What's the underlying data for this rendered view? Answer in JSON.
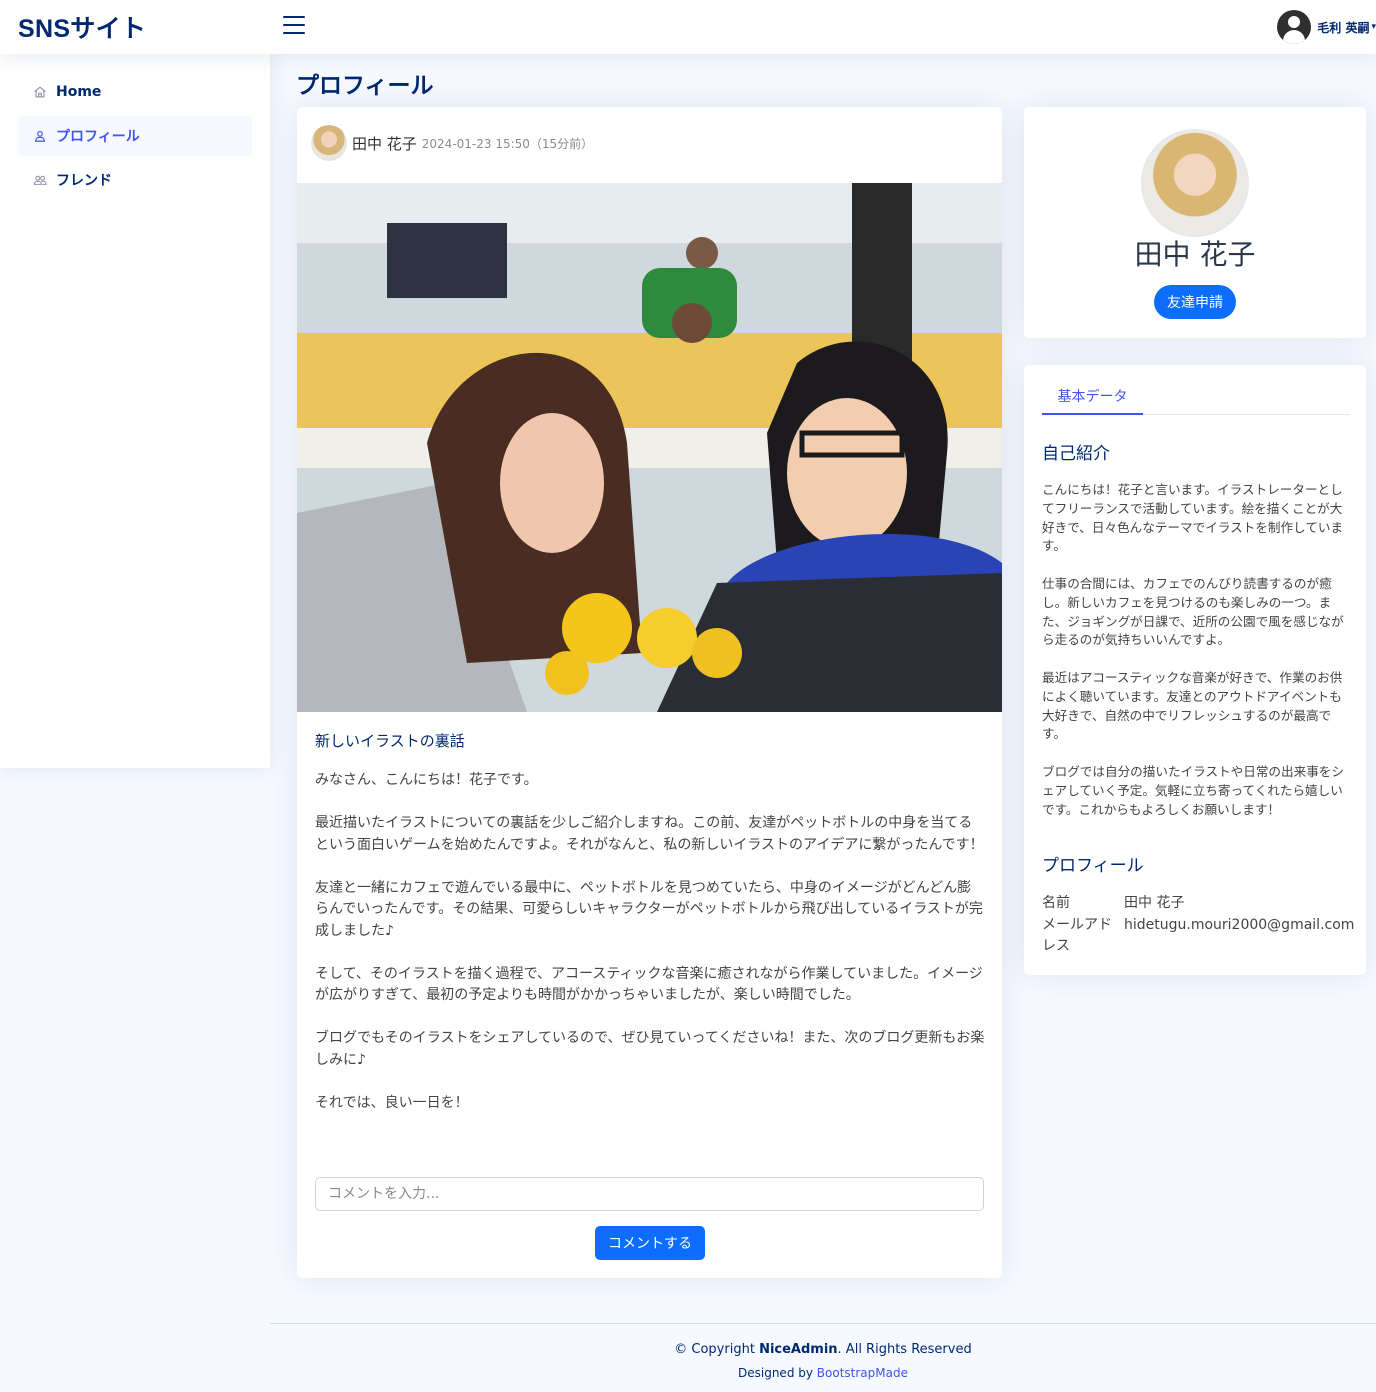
{
  "app": {
    "logo": "SNSサイト"
  },
  "header": {
    "user_name": "毛利 英嗣"
  },
  "sidebar": {
    "items": [
      {
        "label": "Home",
        "icon": "house-icon",
        "active": false
      },
      {
        "label": "プロフィール",
        "icon": "person-icon",
        "active": true
      },
      {
        "label": "フレンド",
        "icon": "people-icon",
        "active": false
      }
    ]
  },
  "page": {
    "title": "プロフィール"
  },
  "post": {
    "author": "田中 花子",
    "date": "2024-01-23 15:50（15分前）",
    "image_alt": "office-photo-two-women-at-computer",
    "title": "新しいイラストの裏話",
    "paragraphs": [
      "みなさん、こんにちは！花子です。",
      "最近描いたイラストについての裏話を少しご紹介しますね。この前、友達がペットボトルの中身を当てるという面白いゲームを始めたんですよ。それがなんと、私の新しいイラストのアイデアに繋がったんです！",
      "友達と一緒にカフェで遊んでいる最中に、ペットボトルを見つめていたら、中身のイメージがどんどん膨らんでいったんです。その結果、可愛らしいキャラクターがペットボトルから飛び出しているイラストが完成しました♪",
      "そして、そのイラストを描く過程で、アコースティックな音楽に癒されながら作業していました。イメージが広がりすぎて、最初の予定よりも時間がかかっちゃいましたが、楽しい時間でした。",
      "ブログでもそのイラストをシェアしているので、ぜひ見ていってくださいね！また、次のブログ更新もお楽しみに♪",
      "それでは、良い一日を！"
    ],
    "comment_placeholder": "コメントを入力...",
    "comment_button": "コメントする"
  },
  "profile": {
    "name": "田中 花子",
    "friend_button": "友達申請"
  },
  "details": {
    "tab": "基本データ",
    "bio_title": "自己紹介",
    "bio": [
      "こんにちは！花子と言います。イラストレーターとしてフリーランスで活動しています。絵を描くことが大好きで、日々色んなテーマでイラストを制作しています。",
      "仕事の合間には、カフェでのんびり読書するのが癒し。新しいカフェを見つけるのも楽しみの一つ。また、ジョギングが日課で、近所の公園で風を感じながら走るのが気持ちいいんですよ。",
      "最近はアコースティックな音楽が好きで、作業のお供によく聴いています。友達とのアウトドアイベントも大好きで、自然の中でリフレッシュするのが最高です。",
      "ブログでは自分の描いたイラストや日常の出来事をシェアしていく予定。気軽に立ち寄ってくれたら嬉しいです。これからもよろしくお願いします！"
    ],
    "profile_title": "プロフィール",
    "name_label": "名前",
    "name_value": "田中 花子",
    "email_label": "メールアドレス",
    "email_value": "hidetugu.mouri2000@gmail.com"
  },
  "footer": {
    "copyright_prefix": "© Copyright ",
    "brand": "NiceAdmin",
    "copyright_suffix": ". All Rights Reserved",
    "designed_by": "Designed by ",
    "designer": "BootstrapMade"
  },
  "colors": {
    "primary": "#0d6efd",
    "navy": "#012970",
    "accent": "#4154f1",
    "background": "#f6f9ff"
  }
}
